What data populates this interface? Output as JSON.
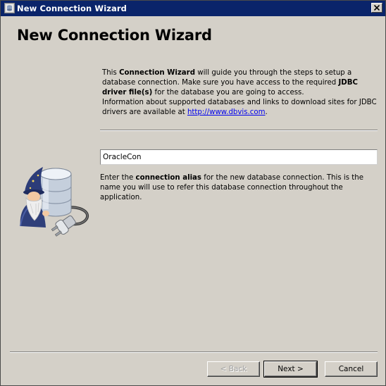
{
  "window": {
    "title": "New Connection Wizard"
  },
  "page": {
    "heading": "New Connection Wizard"
  },
  "intro": {
    "t1": "This ",
    "b1": "Connection Wizard",
    "t2": " will guide you through the steps to setup a database connection. Make sure you have access to the required ",
    "b2": "JDBC driver file(s)",
    "t3": " for the database you are going to access.",
    "t4": "Information about supported databases and links to download sites for JDBC drivers are available at ",
    "link": "http://www.dbvis.com",
    "t5": "."
  },
  "alias_field": {
    "value": "OracleCon"
  },
  "description": {
    "t1": "Enter the ",
    "b1": "connection alias",
    "t2": " for the new database connection. This is the name you will use to refer this database connection throughout the application."
  },
  "buttons": {
    "back": "< Back",
    "next": "Next >",
    "cancel": "Cancel"
  },
  "colors": {
    "titlebar": "#0a246a",
    "dialog_bg": "#d4d0c8",
    "link": "#0000ee"
  },
  "icons": {
    "window": "app-icon",
    "close": "close-icon",
    "illustration": "wizard-database-plug-icon"
  }
}
